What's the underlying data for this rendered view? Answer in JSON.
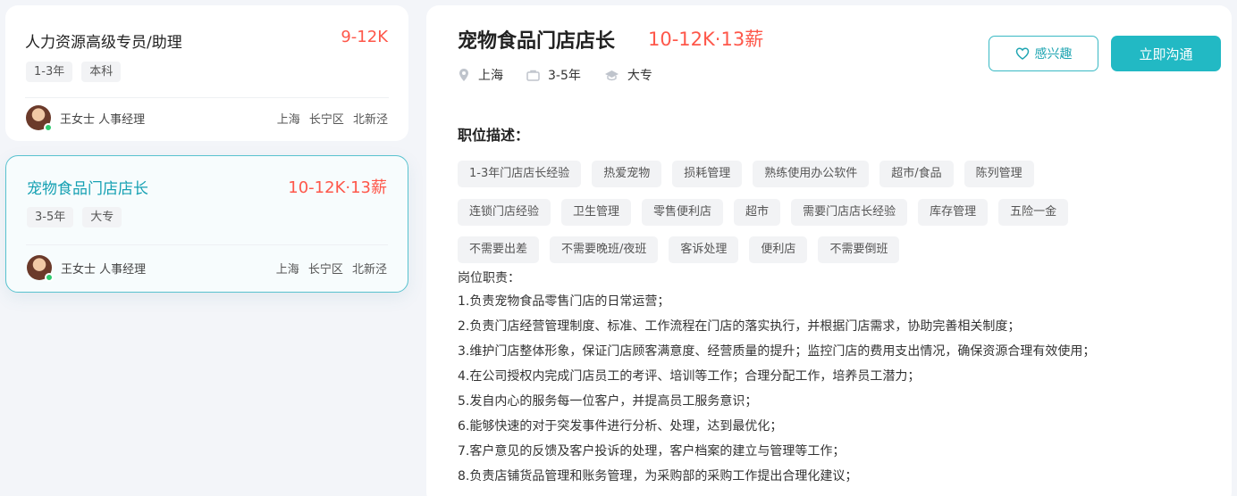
{
  "job_list": [
    {
      "title": "人力资源高级专员/助理",
      "salary": "9-12K",
      "tags": [
        "1-3年",
        "本科"
      ],
      "recruiter": "王女士 人事经理",
      "location": "上海 长宁区 北新泾",
      "selected": false
    },
    {
      "title": "宠物食品门店店长",
      "salary": "10-12K·13薪",
      "tags": [
        "3-5年",
        "大专"
      ],
      "recruiter": "王女士 人事经理",
      "location": "上海 长宁区 北新泾",
      "selected": true
    }
  ],
  "detail": {
    "title": "宠物食品门店店长",
    "salary": "10-12K·13薪",
    "meta": {
      "city": "上海",
      "experience": "3-5年",
      "education": "大专"
    },
    "buttons": {
      "interest": "感兴趣",
      "chat": "立即沟通"
    },
    "section_title": "职位描述：",
    "skill_rows": [
      [
        "1-3年门店店长经验",
        "热爱宠物",
        "损耗管理",
        "熟练使用办公软件",
        "超市/食品",
        "陈列管理"
      ],
      [
        "连锁门店经验",
        "卫生管理",
        "零售便利店",
        "超市",
        "需要门店店长经验",
        "库存管理",
        "五险一金"
      ],
      [
        "不需要出差",
        "不需要晚班/夜班",
        "客诉处理",
        "便利店",
        "不需要倒班"
      ]
    ],
    "description_lines": [
      "岗位职责：",
      "1.负责宠物食品零售门店的日常运营；",
      "2.负责门店经营管理制度、标准、工作流程在门店的落实执行，并根据门店需求，协助完善相关制度；",
      "3.维护门店整体形象，保证门店顾客满意度、经营质量的提升；监控门店的费用支出情况，确保资源合理有效使用；",
      "4.在公司授权内完成门店员工的考评、培训等工作；合理分配工作，培养员工潜力；",
      "5.发自内心的服务每一位客户，并提高员工服务意识；",
      "6.能够快速的对于突发事件进行分析、处理，达到最优化；",
      "7.客户意见的反馈及客户投诉的处理，客户档案的建立与管理等工作；",
      "8.负责店铺货品管理和账务管理，为采购部的采购工作提出合理化建议；"
    ]
  },
  "colors": {
    "accent": "#22b9c4",
    "salary": "#fe574a",
    "selected_title": "#16a1b3"
  },
  "icons": [
    "location-pin-icon",
    "briefcase-icon",
    "graduation-cap-icon",
    "heart-icon",
    "online-status-icon"
  ]
}
